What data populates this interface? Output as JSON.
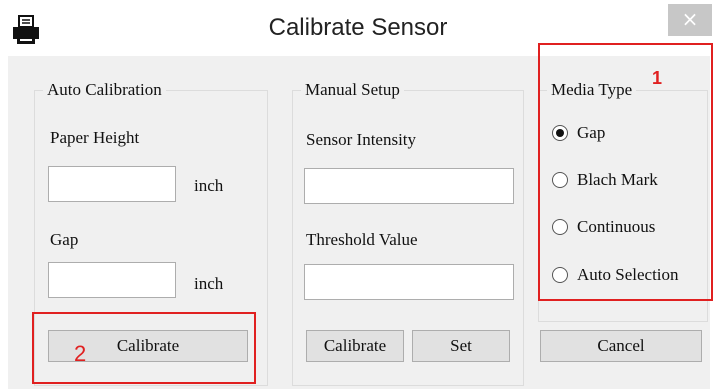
{
  "window": {
    "title": "Calibrate Sensor",
    "icon": "printer-icon",
    "close_glyph": "×"
  },
  "auto_calibration": {
    "legend": "Auto Calibration",
    "paper_height_label": "Paper Height",
    "paper_height_value": "",
    "paper_height_unit": "inch",
    "gap_label": "Gap",
    "gap_value": "",
    "gap_unit": "inch",
    "calibrate_label": "Calibrate"
  },
  "manual_setup": {
    "legend": "Manual Setup",
    "sensor_intensity_label": "Sensor Intensity",
    "sensor_intensity_value": "",
    "threshold_label": "Threshold Value",
    "threshold_value": "",
    "calibrate_label": "Calibrate",
    "set_label": "Set"
  },
  "media_type": {
    "legend": "Media Type",
    "options": [
      "Gap",
      "Blach Mark",
      "Continuous",
      "Auto Selection"
    ],
    "selected": "Gap"
  },
  "cancel_label": "Cancel",
  "annotations": {
    "marker_1": "1",
    "marker_2": "2",
    "color": "#e02020"
  }
}
